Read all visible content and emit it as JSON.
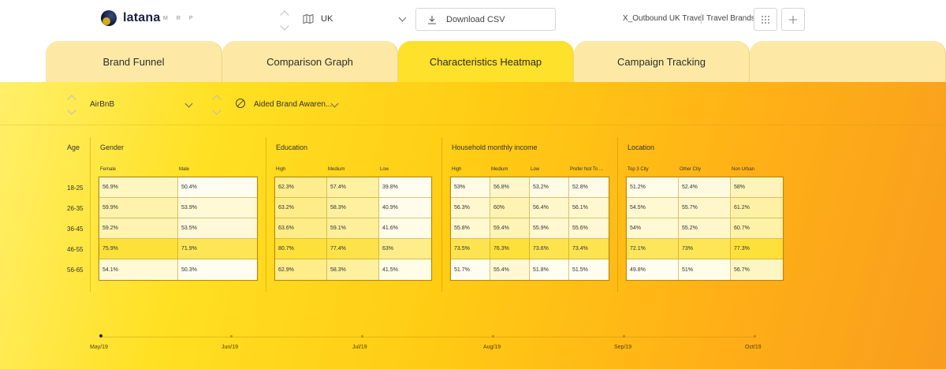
{
  "header": {
    "logo_text": "latana",
    "mrp_letters": [
      "M",
      "R",
      "P"
    ],
    "country": "UK",
    "download_label": "Download CSV",
    "project": "X_Outbound UK Travel",
    "category": "Travel Brands",
    "icons": {
      "map": "map-icon",
      "download": "download-icon",
      "grid": "grid-icon",
      "add": "plus-icon"
    }
  },
  "tabs": [
    {
      "label": "Brand Funnel",
      "active": false
    },
    {
      "label": "Comparison Graph",
      "active": false
    },
    {
      "label": "Characteristics Heatmap",
      "active": true
    },
    {
      "label": "Campaign Tracking",
      "active": false
    }
  ],
  "filters": {
    "brand": "AirBnB",
    "metric": "Aided Brand Awaren..."
  },
  "heatmap": {
    "age_header": "Age",
    "ages": [
      "18-25",
      "26-35",
      "36-45",
      "46-55",
      "56-65"
    ],
    "groups": [
      {
        "title": "Gender",
        "columns": [
          "Female",
          "Male"
        ],
        "rows": [
          [
            "56.9%",
            "50.4%"
          ],
          [
            "59.9%",
            "53.9%"
          ],
          [
            "59.2%",
            "53.5%"
          ],
          [
            "75.9%",
            "71.9%"
          ],
          [
            "54.1%",
            "50.3%"
          ]
        ]
      },
      {
        "title": "Education",
        "columns": [
          "High",
          "Medium",
          "Low"
        ],
        "rows": [
          [
            "62.3%",
            "57.4%",
            "39.8%"
          ],
          [
            "63.2%",
            "58.3%",
            "40.9%"
          ],
          [
            "63.6%",
            "59.1%",
            "41.6%"
          ],
          [
            "80.7%",
            "77.4%",
            "63%"
          ],
          [
            "62.9%",
            "58.3%",
            "41.5%"
          ]
        ]
      },
      {
        "title": "Household monthly income",
        "columns": [
          "High",
          "Medium",
          "Low",
          "Prefer Not To ..."
        ],
        "rows": [
          [
            "53%",
            "56.8%",
            "53.2%",
            "52.8%"
          ],
          [
            "56.3%",
            "60%",
            "56.4%",
            "56.1%"
          ],
          [
            "55.8%",
            "59.4%",
            "55.9%",
            "55.6%"
          ],
          [
            "73.5%",
            "76.3%",
            "73.6%",
            "73.4%"
          ],
          [
            "51.7%",
            "55.4%",
            "51.8%",
            "51.5%"
          ]
        ]
      },
      {
        "title": "Location",
        "columns": [
          "Top 3 City",
          "Other City",
          "Non Urban"
        ],
        "rows": [
          [
            "51.2%",
            "52.4%",
            "58%"
          ],
          [
            "54.5%",
            "55.7%",
            "61.2%"
          ],
          [
            "54%",
            "55.2%",
            "60.7%"
          ],
          [
            "72.1%",
            "73%",
            "77.3%"
          ],
          [
            "49.8%",
            "51%",
            "56.7%"
          ]
        ]
      }
    ],
    "colors": {
      "low": "#fffdf0",
      "high": "#fde03a"
    }
  },
  "timeline": {
    "labels": [
      "May/19",
      "Jun/19",
      "Jul/19",
      "Aug/19",
      "Sep/19",
      "Oct/19"
    ],
    "current": "May/19"
  }
}
